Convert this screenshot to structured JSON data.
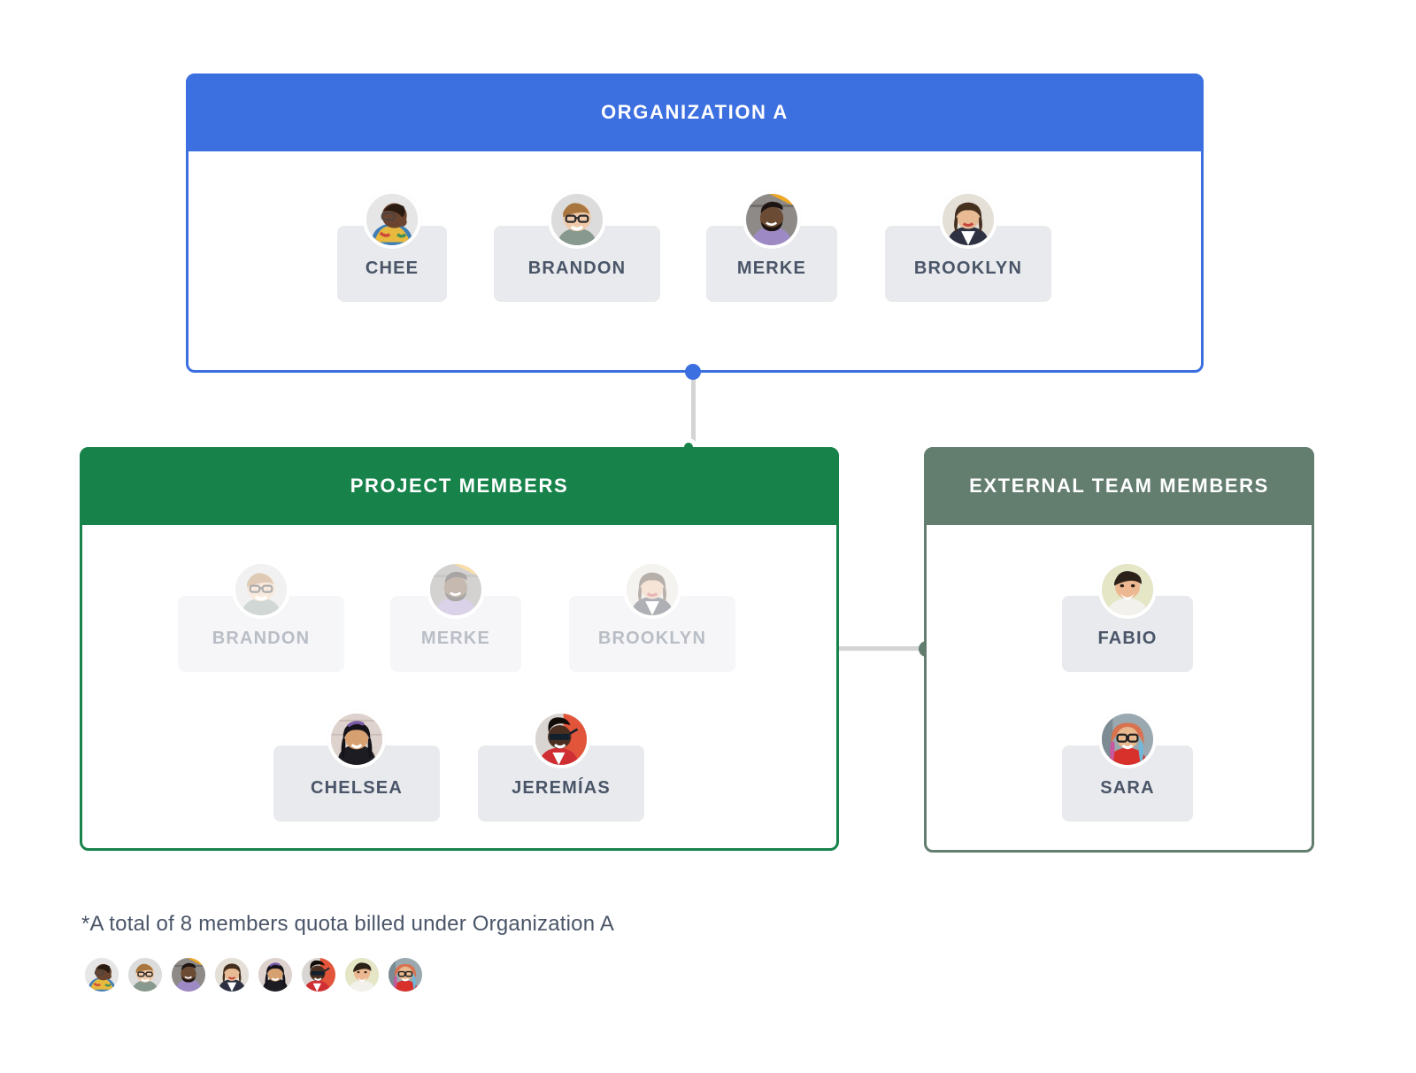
{
  "colors": {
    "org_blue": "#3c6fdf",
    "project_green": "#17834b",
    "external_sage": "#637d6f",
    "card_gray": "#e8eaed",
    "name_text": "#4a5568",
    "connector_gray": "#d4d4d4",
    "page_background": "#ffffff"
  },
  "organization": {
    "title": "ORGANIZATION A",
    "members": [
      {
        "name": "CHEE",
        "avatar_icon": "avatar-chee",
        "dimmed": false
      },
      {
        "name": "BRANDON",
        "avatar_icon": "avatar-brandon",
        "dimmed": false
      },
      {
        "name": "MERKE",
        "avatar_icon": "avatar-merke",
        "dimmed": false
      },
      {
        "name": "BROOKLYN",
        "avatar_icon": "avatar-brooklyn",
        "dimmed": false
      }
    ]
  },
  "project_members": {
    "title": "PROJECT MEMBERS",
    "shared_members": [
      {
        "name": "BRANDON",
        "avatar_icon": "avatar-brandon",
        "dimmed": true
      },
      {
        "name": "MERKE",
        "avatar_icon": "avatar-merke",
        "dimmed": true
      },
      {
        "name": "BROOKLYN",
        "avatar_icon": "avatar-brooklyn",
        "dimmed": true
      }
    ],
    "own_members": [
      {
        "name": "CHELSEA",
        "avatar_icon": "avatar-chelsea",
        "dimmed": false
      },
      {
        "name": "JEREMÍAS",
        "avatar_icon": "avatar-jeremias",
        "dimmed": false
      }
    ]
  },
  "external_members": {
    "title": "EXTERNAL TEAM MEMBERS",
    "members": [
      {
        "name": "FABIO",
        "avatar_icon": "avatar-fabio",
        "dimmed": false
      },
      {
        "name": "SARA",
        "avatar_icon": "avatar-sara",
        "dimmed": false
      }
    ]
  },
  "footer": {
    "note": "*A total of 8 members quota billed under Organization A",
    "avatars": [
      "avatar-chee",
      "avatar-brandon",
      "avatar-merke",
      "avatar-brooklyn",
      "avatar-chelsea",
      "avatar-jeremias",
      "avatar-fabio",
      "avatar-sara"
    ]
  }
}
